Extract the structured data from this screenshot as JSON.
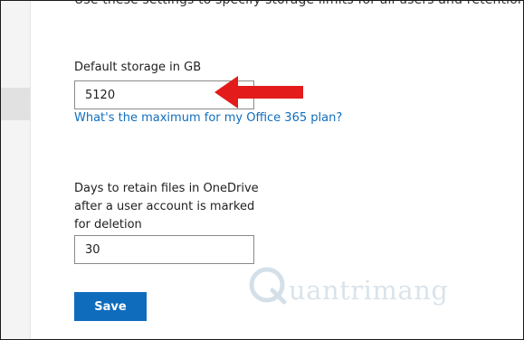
{
  "header": {
    "cut_off_text": "Use these settings to specify storage limits for all users and retention of"
  },
  "storage": {
    "label": "Default storage in GB",
    "value": "5120",
    "help_link": "What's the maximum for my Office 365 plan?"
  },
  "retention": {
    "label": "Days to retain files in OneDrive after a user account is marked for deletion",
    "value": "30"
  },
  "actions": {
    "save_label": "Save"
  },
  "watermark": {
    "text": "uantrimang"
  },
  "colors": {
    "accent": "#0f6cbd",
    "link": "#106ebe",
    "annotation_arrow": "#e31b1b"
  },
  "icons": {
    "annotation": "red-arrow-icon",
    "watermark_logo": "quantrimang-logo-icon"
  }
}
